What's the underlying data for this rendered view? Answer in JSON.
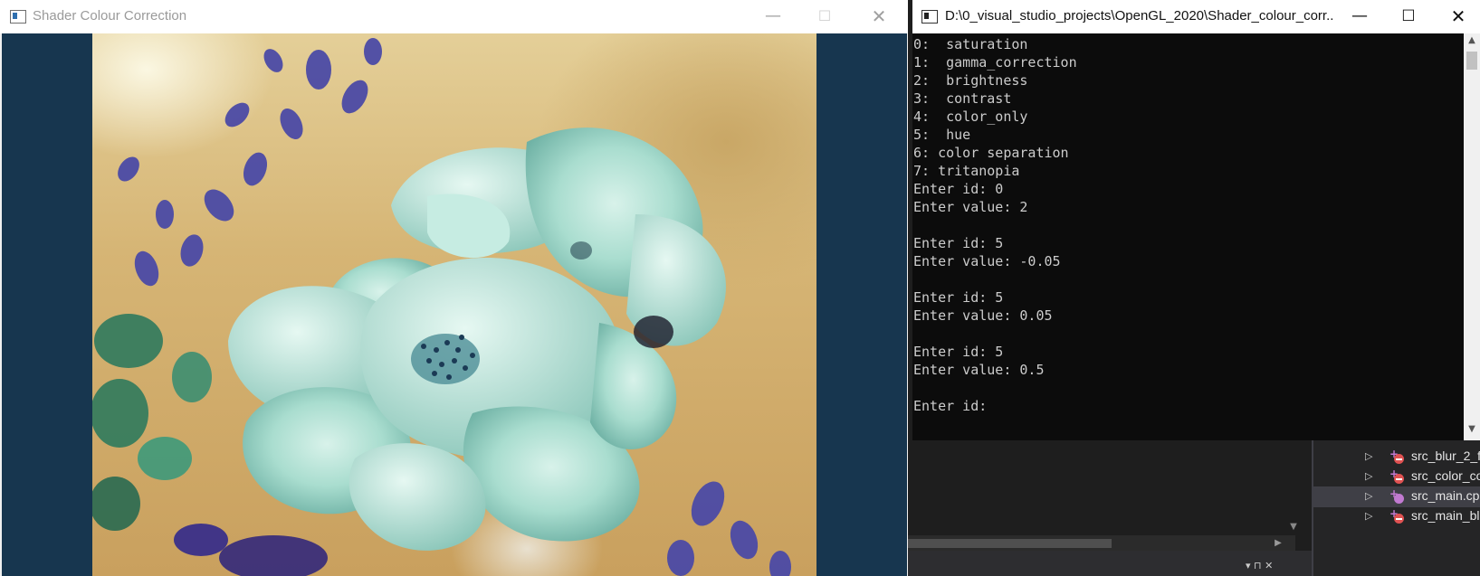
{
  "gl_window": {
    "title": "Shader Colour Correction",
    "minimize_glyph": "—",
    "maximize_glyph": "☐",
    "close_glyph": "✕",
    "background_color": "#17364f"
  },
  "console_window": {
    "title": "D:\\0_visual_studio_projects\\OpenGL_2020\\Shader_colour_corr...",
    "minimize_glyph": "—",
    "maximize_glyph": "☐",
    "close_glyph": "✕",
    "lines": [
      "0:  saturation",
      "1:  gamma_correction",
      "2:  brightness",
      "3:  contrast",
      "4:  color_only",
      "5:  hue",
      "6: color separation",
      "7: tritanopia",
      "Enter id: 0",
      "Enter value: 2",
      "",
      "Enter id: 5",
      "Enter value: -0.05",
      "",
      "Enter id: 5",
      "Enter value: 0.05",
      "",
      "Enter id: 5",
      "Enter value: 0.5",
      "",
      "Enter id: "
    ]
  },
  "solution_explorer": {
    "items": [
      {
        "label": "src_blur_2_f",
        "icon": "cpp-file-excluded-icon",
        "selected": false
      },
      {
        "label": "src_color_co",
        "icon": "cpp-file-excluded-icon",
        "selected": false
      },
      {
        "label": "src_main.cp",
        "icon": "cpp-file-icon",
        "selected": true
      },
      {
        "label": "src_main_bl",
        "icon": "cpp-file-excluded-icon",
        "selected": false
      }
    ]
  },
  "ide": {
    "mini_controls": "▾ ⊓ ✕"
  }
}
